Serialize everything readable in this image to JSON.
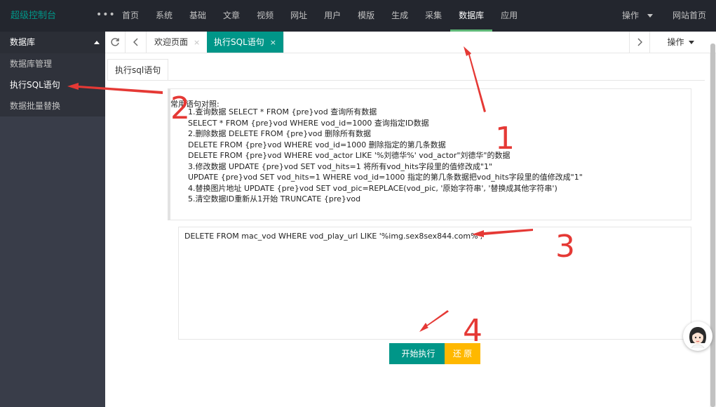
{
  "topbar": {
    "brand": "超级控制台",
    "more": "•••",
    "nav": [
      "首页",
      "系统",
      "基础",
      "文章",
      "视频",
      "网址",
      "用户",
      "模版",
      "生成",
      "采集",
      "数据库",
      "应用"
    ],
    "active_nav": "数据库",
    "right": {
      "ops": "操作",
      "site_home": "网站首页"
    }
  },
  "sidebar": {
    "header": "数据库",
    "items": [
      {
        "label": "数据库管理",
        "active": false
      },
      {
        "label": "执行SQL语句",
        "active": true
      },
      {
        "label": "数据批量替换",
        "active": false
      }
    ]
  },
  "tabbar": {
    "tabs": [
      {
        "label": "欢迎页面",
        "active": false
      },
      {
        "label": "执行SQL语句",
        "active": true
      }
    ],
    "close_glyph": "×",
    "ops": "操作"
  },
  "content": {
    "inner_tab": "执行sql语句",
    "tips": {
      "title": "常用语句对照:",
      "lines": [
        "1.查询数据 SELECT * FROM {pre}vod 查询所有数据",
        "SELECT * FROM {pre}vod WHERE vod_id=1000 查询指定ID数据",
        "2.删除数据 DELETE FROM {pre}vod 删除所有数据",
        "DELETE FROM {pre}vod WHERE vod_id=1000 删除指定的第几条数据",
        "DELETE FROM {pre}vod WHERE vod_actor LIKE '%刘德华%' vod_actor\"刘德华\"的数据",
        "3.修改数据 UPDATE {pre}vod SET vod_hits=1 将所有vod_hits字段里的值修改成\"1\"",
        "UPDATE {pre}vod SET vod_hits=1 WHERE vod_id=1000 指定的第几条数据把vod_hits字段里的值修改成\"1\"",
        "4.替换图片地址 UPDATE {pre}vod SET vod_pic=REPLACE(vod_pic, '原始字符串', '替换成其他字符串')",
        "5.清空数据ID重新从1开始 TRUNCATE {pre}vod"
      ]
    },
    "sql_value": "DELETE FROM mac_vod WHERE vod_play_url LIKE '%img.sex8sex844.com%';",
    "run_button": "开始执行",
    "reset_button": "还 原"
  },
  "annotations": [
    "1",
    "2",
    "3",
    "4"
  ],
  "colors": {
    "topbar_bg": "#23262e",
    "sidebar_bg": "#393d49",
    "accent": "#009688",
    "warn": "#ffb800",
    "annotation": "#e53935"
  }
}
